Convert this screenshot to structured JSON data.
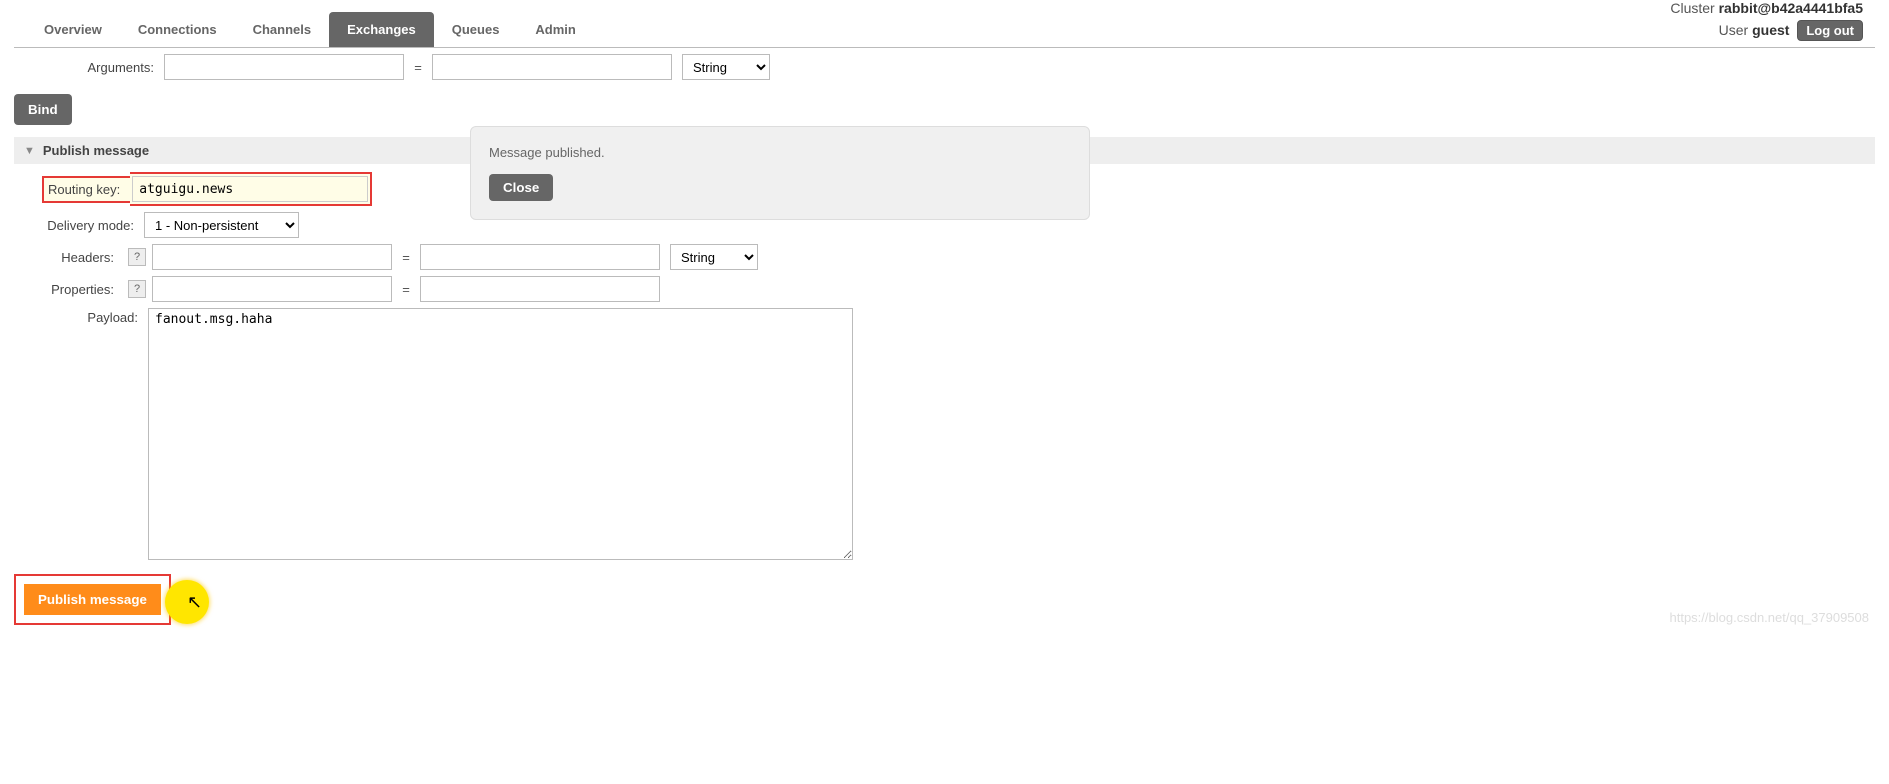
{
  "cluster": {
    "label": "Cluster",
    "name": "rabbit@b42a4441bfa5"
  },
  "user": {
    "label": "User",
    "name": "guest",
    "logout_label": "Log out"
  },
  "tabs": {
    "overview": "Overview",
    "connections": "Connections",
    "channels": "Channels",
    "exchanges": "Exchanges",
    "queues": "Queues",
    "admin": "Admin"
  },
  "arguments": {
    "label": "Arguments:",
    "key": "",
    "value": "",
    "type_selected": "String"
  },
  "bind_button": "Bind",
  "section": {
    "title": "Publish message"
  },
  "publish": {
    "routing_key_label": "Routing key:",
    "routing_key_value": "atguigu.news",
    "delivery_mode_label": "Delivery mode:",
    "delivery_mode_selected": "1 - Non-persistent",
    "headers_label": "Headers:",
    "headers_help": "?",
    "headers_key": "",
    "headers_value": "",
    "headers_type": "String",
    "properties_label": "Properties:",
    "properties_help": "?",
    "properties_key": "",
    "properties_value": "",
    "payload_label": "Payload:",
    "payload_value": "fanout.msg.haha",
    "publish_button": "Publish message"
  },
  "flash": {
    "message": "Message published.",
    "close": "Close"
  },
  "watermark": "https://blog.csdn.net/qq_37909508"
}
